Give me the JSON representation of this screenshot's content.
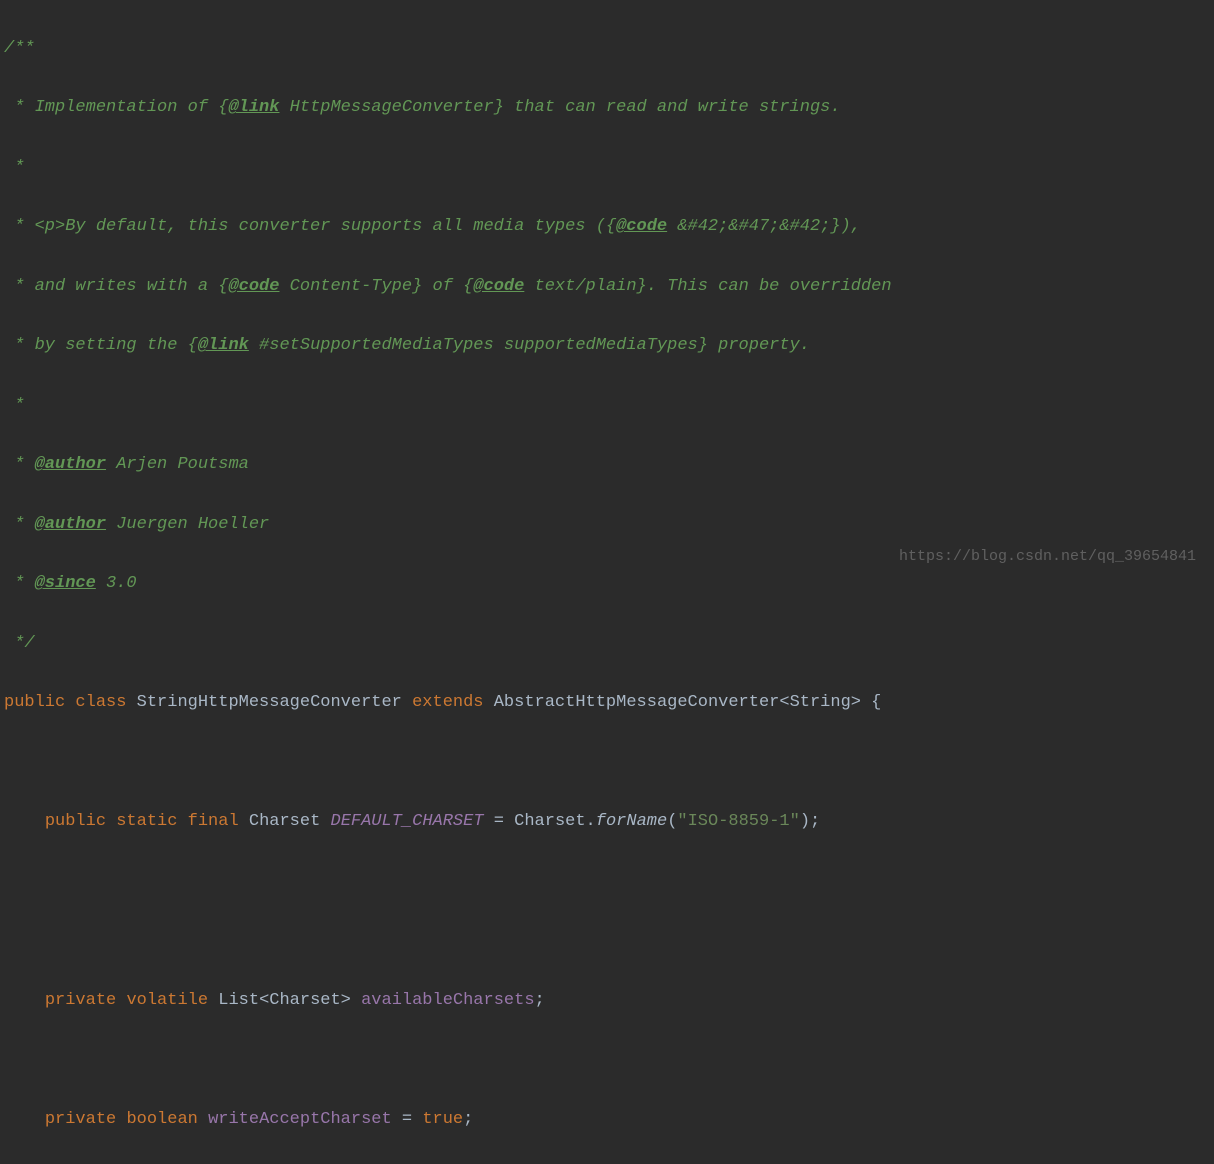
{
  "javadoc": {
    "line1_prefix": "/**",
    "line2_prefix": " * ",
    "line2_text1": "Implementation of {",
    "line2_tag": "@link",
    "line2_text2": " HttpMessageConverter} that can read and write strings.",
    "line3": " *",
    "line4_prefix": " * ",
    "line4_text1": "<p>By default, this converter supports all media types ({",
    "line4_tag": "@code",
    "line4_text2": " &#42;&#47;&#42;}),",
    "line5_prefix": " * ",
    "line5_text1": "and writes with a {",
    "line5_tag1": "@code",
    "line5_text2": " Content-Type} of {",
    "line5_tag2": "@code",
    "line5_text3": " text/plain}. This can be overridden",
    "line6_prefix": " * ",
    "line6_text1": "by setting the {",
    "line6_tag": "@link",
    "line6_text2": " #setSupportedMediaTypes supportedMediaTypes} property.",
    "line7": " *",
    "line8_prefix": " * ",
    "line8_tag": "@author",
    "line8_text": " Arjen Poutsma",
    "line9_prefix": " * ",
    "line9_tag": "@author",
    "line9_text": " Juergen Hoeller",
    "line10_prefix": " * ",
    "line10_tag": "@since",
    "line10_text": " 3.0",
    "line11": " */"
  },
  "code": {
    "class_decl": {
      "kw_public": "public",
      "kw_class": "class",
      "class_name": "StringHttpMessageConverter",
      "kw_extends": "extends",
      "parent_class": "AbstractHttpMessageConverter<String> {"
    },
    "field1": {
      "indent": "    ",
      "kw_public": "public",
      "kw_static": "static",
      "kw_final": "final",
      "type": "Charset",
      "name": "DEFAULT_CHARSET",
      "eq": " = ",
      "call_obj": "Charset.",
      "call_method": "forName",
      "paren_open": "(",
      "string_val": "\"ISO-8859-1\"",
      "paren_close": ");"
    },
    "field2": {
      "indent": "    ",
      "kw_private": "private",
      "kw_volatile": "volatile",
      "type": "List<Charset>",
      "name": "availableCharsets",
      "semi": ";"
    },
    "field3": {
      "indent": "    ",
      "kw_private": "private",
      "kw_boolean": "boolean",
      "name": "writeAcceptCharset",
      "eq": " = ",
      "kw_true": "true",
      "semi": ";"
    }
  },
  "watermark": "https://blog.csdn.net/qq_39654841"
}
